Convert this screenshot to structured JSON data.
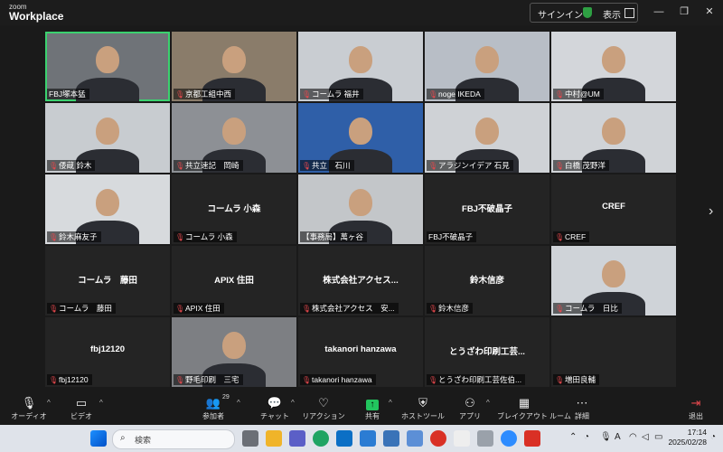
{
  "app": {
    "logo_top": "zoom",
    "logo_bottom": "Workplace"
  },
  "titlebar": {
    "signin": "サインイン",
    "view": "表示"
  },
  "participants": [
    {
      "name": "FBJ塚本猛",
      "display": "",
      "video": true,
      "active": true,
      "muted": false
    },
    {
      "name": "京都工組中西",
      "display": "",
      "video": true,
      "active": false,
      "muted": true
    },
    {
      "name": "コームラ 福井",
      "display": "",
      "video": true,
      "active": false,
      "muted": true
    },
    {
      "name": "noge IKEDA",
      "display": "",
      "video": true,
      "active": false,
      "muted": true
    },
    {
      "name": "中村@UM",
      "display": "",
      "video": true,
      "active": false,
      "muted": true
    },
    {
      "name": "倭蔵 鈴木",
      "display": "",
      "video": true,
      "active": false,
      "muted": true
    },
    {
      "name": "共立速記　岡崎",
      "display": "",
      "video": true,
      "active": false,
      "muted": true
    },
    {
      "name": "共立　石川",
      "display": "",
      "video": true,
      "active": false,
      "muted": true
    },
    {
      "name": "アラジンイデア 石見",
      "display": "",
      "video": true,
      "active": false,
      "muted": true
    },
    {
      "name": "白橋 茂野洋",
      "display": "",
      "video": true,
      "active": false,
      "muted": true
    },
    {
      "name": "鈴木麻友子",
      "display": "",
      "video": true,
      "active": false,
      "muted": true
    },
    {
      "name": "コームラ 小森",
      "display": "コームラ 小森",
      "video": false,
      "active": false,
      "muted": true
    },
    {
      "name": "【事務局】萬ヶ谷",
      "display": "",
      "video": true,
      "active": false,
      "muted": false
    },
    {
      "name": "FBJ不破晶子",
      "display": "FBJ不破晶子",
      "video": false,
      "active": false,
      "muted": false
    },
    {
      "name": "CREF",
      "display": "CREF",
      "video": false,
      "active": false,
      "muted": true
    },
    {
      "name": "コームラ　藤田",
      "display": "コームラ　藤田",
      "video": false,
      "active": false,
      "muted": true
    },
    {
      "name": "APIX 住田",
      "display": "APIX 住田",
      "video": false,
      "active": false,
      "muted": true
    },
    {
      "name": "株式会社アクセス　安...",
      "display": "株式会社アクセス...",
      "video": false,
      "active": false,
      "muted": true
    },
    {
      "name": "鈴木信彦",
      "display": "鈴木信彦",
      "video": false,
      "active": false,
      "muted": true
    },
    {
      "name": "コームラ　日比",
      "display": "",
      "video": true,
      "active": false,
      "muted": true
    },
    {
      "name": "fbj12120",
      "display": "fbj12120",
      "video": false,
      "active": false,
      "muted": true
    },
    {
      "name": "野毛印刷　三宅",
      "display": "",
      "video": true,
      "active": false,
      "muted": true
    },
    {
      "name": "takanori hanzawa",
      "display": "takanori hanzawa",
      "video": false,
      "active": false,
      "muted": true
    },
    {
      "name": "とうざわ印刷工芸佐伯...",
      "display": "とうざわ印刷工芸...",
      "video": false,
      "active": false,
      "muted": true
    },
    {
      "name": "増田良輔",
      "display": "",
      "video": false,
      "active": false,
      "muted": true
    }
  ],
  "toolbar": {
    "audio": "オーディオ",
    "video": "ビデオ",
    "participants": "参加者",
    "participant_count": "29",
    "chat": "チャット",
    "reactions": "リアクション",
    "share": "共有",
    "host_tools": "ホストツール",
    "apps": "アプリ",
    "breakout": "ブレイクアウト ルーム",
    "more": "詳細",
    "leave": "退出"
  },
  "taskbar": {
    "search_placeholder": "検索",
    "time": "17:14",
    "date": "2025/02/28",
    "ime": "A"
  },
  "colors": {
    "active_speaker": "#3bd16f",
    "leave": "#e5484d",
    "share": "#22c55e",
    "muted": "#e5484d"
  }
}
